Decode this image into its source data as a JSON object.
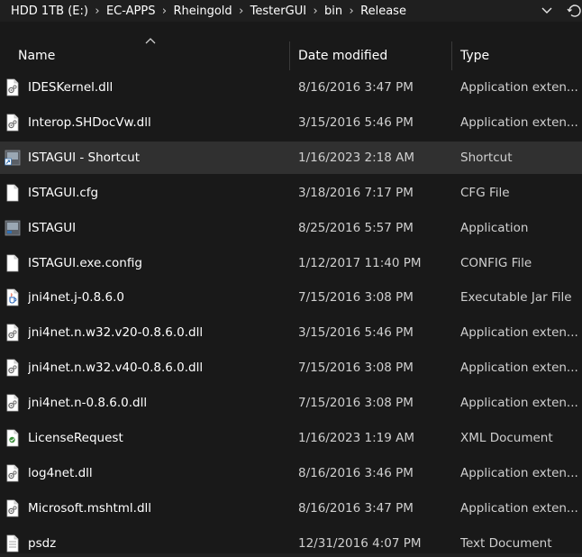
{
  "breadcrumb": [
    "HDD 1TB (E:)",
    "EC-APPS",
    "Rheingold",
    "TesterGUI",
    "bin",
    "Release"
  ],
  "breadcrumb_separator": "›",
  "toolbar": {
    "history_dropdown_icon": "chevron-down-icon",
    "refresh_icon": "refresh-icon"
  },
  "columns": {
    "name": "Name",
    "date": "Date modified",
    "type": "Type",
    "sort": "ascending"
  },
  "files": [
    {
      "name": "IDESKernel.dll",
      "date": "8/16/2016 3:47 PM",
      "type": "Application exten...",
      "icon": "dll-file-icon",
      "selected": false
    },
    {
      "name": "Interop.SHDocVw.dll",
      "date": "3/15/2016 5:46 PM",
      "type": "Application exten...",
      "icon": "dll-file-icon",
      "selected": false
    },
    {
      "name": "ISTAGUI - Shortcut",
      "date": "1/16/2023 2:18 AM",
      "type": "Shortcut",
      "icon": "shortcut-icon",
      "selected": true
    },
    {
      "name": "ISTAGUI.cfg",
      "date": "3/18/2016 7:17 PM",
      "type": "CFG File",
      "icon": "blank-file-icon",
      "selected": false
    },
    {
      "name": "ISTAGUI",
      "date": "8/25/2016 5:57 PM",
      "type": "Application",
      "icon": "application-icon",
      "selected": false
    },
    {
      "name": "ISTAGUI.exe.config",
      "date": "1/12/2017 11:40 PM",
      "type": "CONFIG File",
      "icon": "blank-file-icon",
      "selected": false
    },
    {
      "name": "jni4net.j-0.8.6.0",
      "date": "7/15/2016 3:08 PM",
      "type": "Executable Jar File",
      "icon": "jar-file-icon",
      "selected": false
    },
    {
      "name": "jni4net.n.w32.v20-0.8.6.0.dll",
      "date": "3/15/2016 5:46 PM",
      "type": "Application exten...",
      "icon": "dll-file-icon",
      "selected": false
    },
    {
      "name": "jni4net.n.w32.v40-0.8.6.0.dll",
      "date": "7/15/2016 3:08 PM",
      "type": "Application exten...",
      "icon": "dll-file-icon",
      "selected": false
    },
    {
      "name": "jni4net.n-0.8.6.0.dll",
      "date": "7/15/2016 3:08 PM",
      "type": "Application exten...",
      "icon": "dll-file-icon",
      "selected": false
    },
    {
      "name": "LicenseRequest",
      "date": "1/16/2023 1:19 AM",
      "type": "XML Document",
      "icon": "xml-file-icon",
      "selected": false
    },
    {
      "name": "log4net.dll",
      "date": "8/16/2016 3:46 PM",
      "type": "Application exten...",
      "icon": "dll-file-icon",
      "selected": false
    },
    {
      "name": "Microsoft.mshtml.dll",
      "date": "8/16/2016 3:47 PM",
      "type": "Application exten...",
      "icon": "dll-file-icon",
      "selected": false
    },
    {
      "name": "psdz",
      "date": "12/31/2016 4:07 PM",
      "type": "Text Document",
      "icon": "text-file-icon",
      "selected": false
    }
  ],
  "colors": {
    "background": "#191919",
    "selected_row": "#303030",
    "text_primary": "#ffffff",
    "text_secondary": "#cfcfcf"
  }
}
